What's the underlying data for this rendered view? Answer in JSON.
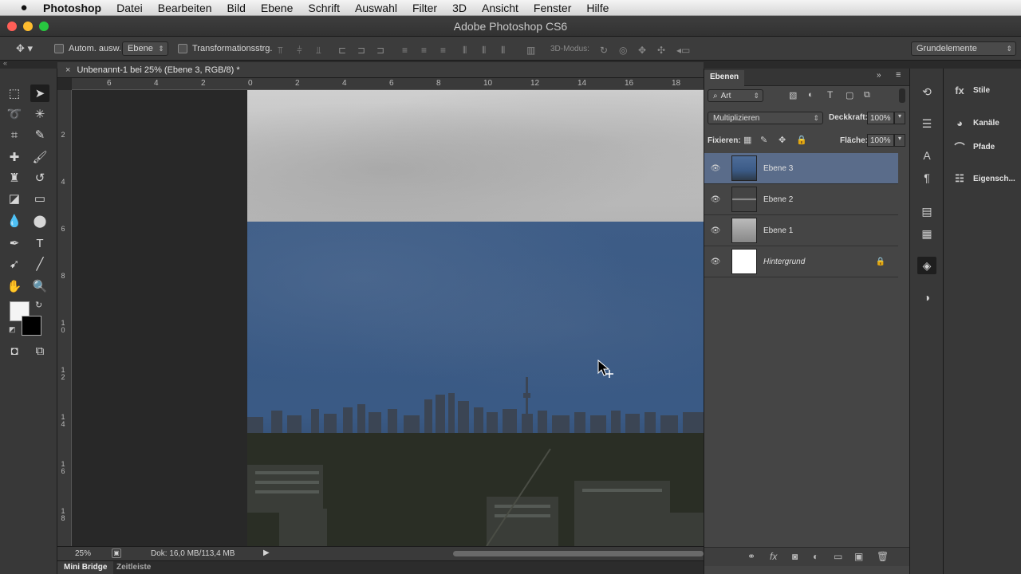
{
  "menubar": {
    "apple": "",
    "app": "Photoshop",
    "items": [
      "Datei",
      "Bearbeiten",
      "Bild",
      "Ebene",
      "Schrift",
      "Auswahl",
      "Filter",
      "3D",
      "Ansicht",
      "Fenster",
      "Hilfe"
    ]
  },
  "window": {
    "title": "Adobe Photoshop CS6"
  },
  "options": {
    "auto_select_label": "Autom. ausw.:",
    "auto_select_value": "Ebene",
    "transform_label": "Transformationsstrg.",
    "mode3d_label": "3D-Modus:",
    "workspace": "Grundelemente"
  },
  "document": {
    "tab_title": "Unbenannt-1 bei 25% (Ebene 3, RGB/8) *",
    "close": "×"
  },
  "ruler": {
    "h": [
      "6",
      "4",
      "2",
      "0",
      "2",
      "4",
      "6",
      "8",
      "10",
      "12",
      "14",
      "16",
      "18"
    ],
    "v": [
      "2",
      "4",
      "6",
      "8",
      "10",
      "12",
      "14",
      "16",
      "18"
    ]
  },
  "status": {
    "zoom": "25%",
    "doc": "Dok: 16,0 MB/113,4 MB"
  },
  "bottom_tabs": [
    "Mini Bridge",
    "Zeitleiste"
  ],
  "layers_panel": {
    "title": "Ebenen",
    "filter": "Art",
    "blend_mode": "Multiplizieren",
    "opacity_label": "Deckkraft:",
    "opacity": "100%",
    "lock_label": "Fixieren:",
    "fill_label": "Fläche:",
    "fill": "100%",
    "layers": [
      {
        "name": "Ebene 3",
        "selected": true
      },
      {
        "name": "Ebene 2",
        "selected": false
      },
      {
        "name": "Ebene 1",
        "selected": false
      },
      {
        "name": "Hintergrund",
        "selected": false,
        "locked": true
      }
    ]
  },
  "right_panel": {
    "items": [
      "Stile",
      "Kanäle",
      "Pfade",
      "Eigensch..."
    ]
  }
}
